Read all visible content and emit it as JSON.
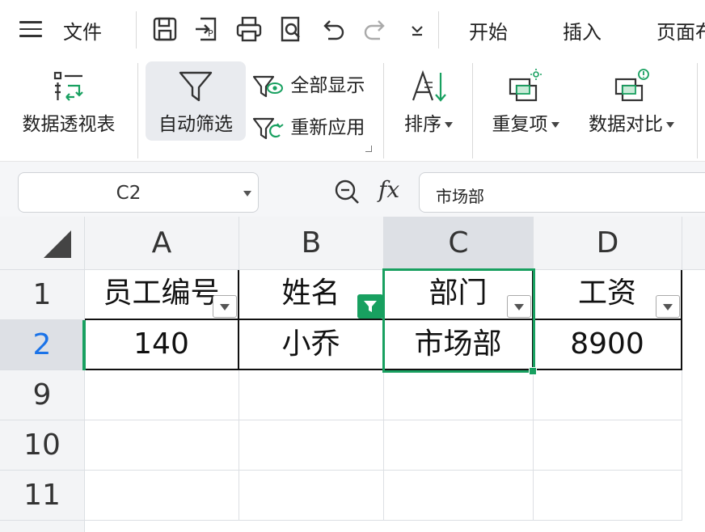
{
  "menu": {
    "file_label": "文件",
    "quick_access": [
      "save-icon",
      "export-icon",
      "print-icon",
      "print-preview-icon",
      "undo-icon",
      "redo-icon",
      "customize-dropdown-icon"
    ]
  },
  "tabs": [
    {
      "label": "开始"
    },
    {
      "label": "插入"
    },
    {
      "label": "页面布"
    }
  ],
  "ribbon": {
    "pivot_table": "数据透视表",
    "auto_filter": "自动筛选",
    "show_all": "全部显示",
    "reapply": "重新应用",
    "sort": "排序",
    "duplicates": "重复项",
    "compare": "数据对比"
  },
  "formula_bar": {
    "name_box": "C2",
    "fx": "fx",
    "content": "市场部"
  },
  "columns": [
    "A",
    "B",
    "C",
    "D"
  ],
  "rows": [
    {
      "num": "1",
      "cells": [
        "员工编号",
        "姓名",
        "部门",
        "工资"
      ]
    },
    {
      "num": "2",
      "cells": [
        "140",
        "小乔",
        "市场部",
        "8900"
      ]
    },
    {
      "num": "9",
      "cells": [
        "",
        "",
        "",
        ""
      ]
    },
    {
      "num": "10",
      "cells": [
        "",
        "",
        "",
        ""
      ]
    },
    {
      "num": "11",
      "cells": [
        "",
        "",
        "",
        ""
      ]
    }
  ],
  "selection": {
    "cell": "C2"
  },
  "colors": {
    "accent": "#18a060",
    "selected_header": "#dde0e5",
    "header_bg": "#f3f4f6",
    "row_selected_text": "#1a73e8"
  }
}
